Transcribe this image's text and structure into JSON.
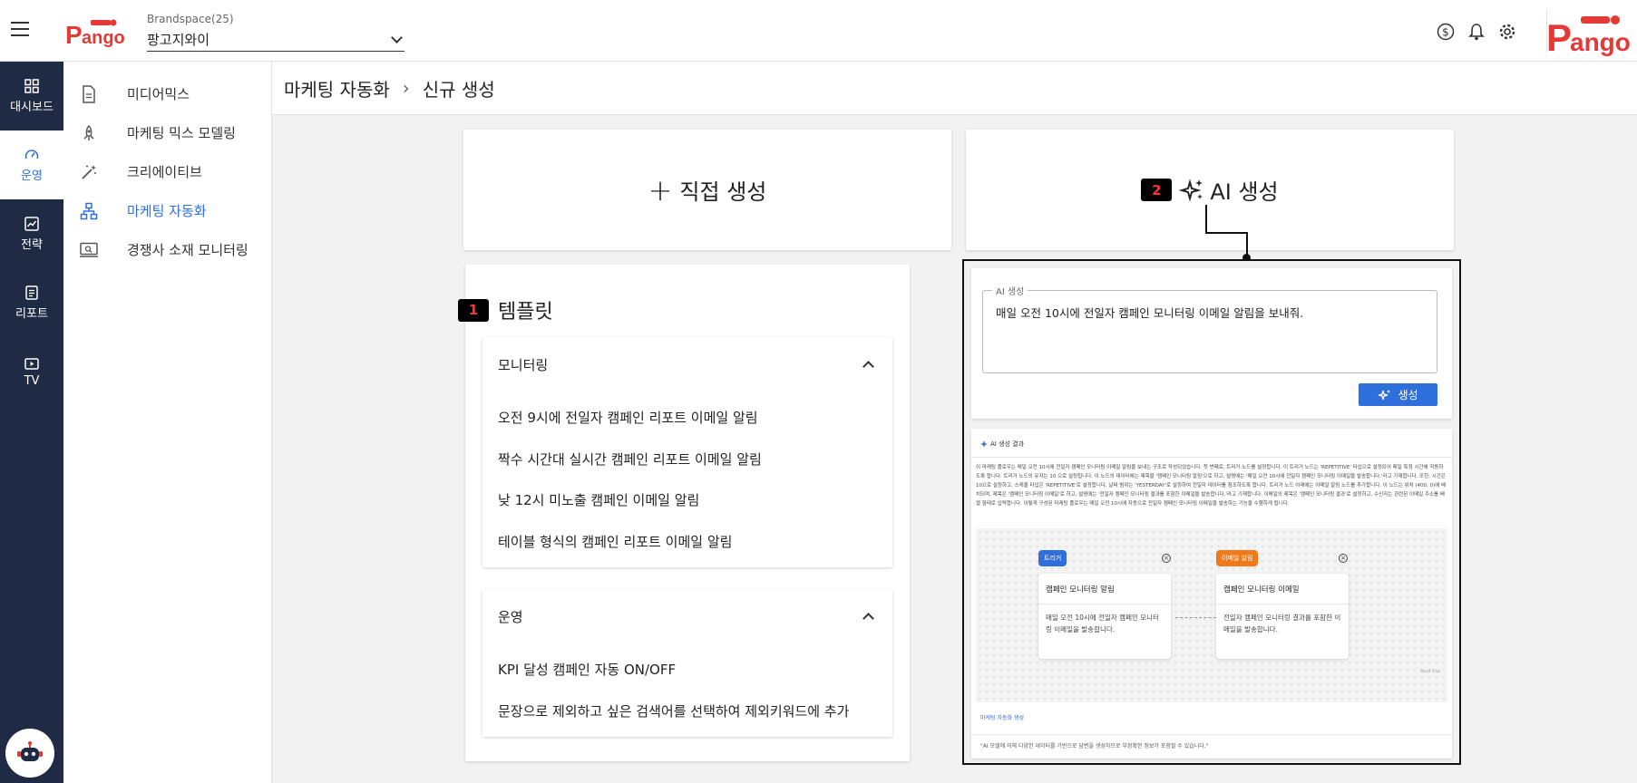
{
  "topbar": {
    "brandspace_label": "Brandspace(25)",
    "brandspace_value": "팡고지와이"
  },
  "rail": [
    {
      "label": "대시보드",
      "icon": "dashboard-icon"
    },
    {
      "label": "운영",
      "icon": "speedometer-icon",
      "active": true
    },
    {
      "label": "전략",
      "icon": "chart-icon"
    },
    {
      "label": "리포트",
      "icon": "report-icon"
    },
    {
      "label": "TV",
      "icon": "tv-icon"
    }
  ],
  "subnav": [
    {
      "label": "미디어믹스",
      "icon": "document-icon"
    },
    {
      "label": "마케팅 믹스 모델링",
      "icon": "rocket-icon"
    },
    {
      "label": "크리에이티브",
      "icon": "magic-wand-icon"
    },
    {
      "label": "마케팅 자동화",
      "icon": "hierarchy-icon",
      "active": true
    },
    {
      "label": "경쟁사 소재 모니터링",
      "icon": "monitor-icon"
    }
  ],
  "breadcrumb": {
    "parent": "마케팅 자동화",
    "separator": "›",
    "current": "신규 생성"
  },
  "create": {
    "direct_label": "직접 생성",
    "ai_label": "AI 생성",
    "ai_badge": "2"
  },
  "template": {
    "badge": "1",
    "title": "템플릿",
    "sections": [
      {
        "name": "모니터링",
        "items": [
          "오전 9시에 전일자 캠페인 리포트 이메일 알림",
          "짝수 시간대 실시간 캠페인 리포트 이메일 알림",
          "낮 12시 미노출 캠페인 이메일 알림",
          "테이블 형식의 캠페인 리포트 이메일 알림"
        ]
      },
      {
        "name": "운영",
        "items": [
          "KPI 달성 캠페인 자동 ON/OFF",
          "문장으로 제외하고 싶은 검색어를 선택하여 제외키워드에 추가"
        ]
      }
    ]
  },
  "ai": {
    "field_label": "AI 생성",
    "field_value": "매일 오전 10시에 전일자 캠페인 모니터링 이메일 알림을 보내줘.",
    "generate_label": "생성",
    "result_title": "AI 생성 결과",
    "result_desc": "이 마케팅 플로우는 매일 오전 10시에 전일자 캠페인 모니터링 이메일 알림을 보내는 구조로 작성되었습니다. 첫 번째로, 트리거 노드를 설정합니다. 이 트리거 노드는 'REPETITIVE' 타입으로 설정되어 매일 특정 시간에 작동하도록 합니다. 트리거 노드의 유지는 10 으로 설정됩니다. 이 노드의 데이터에는 제목을 '캠페인 모니터링 알림'으로 하고, 설명에는 '매일 오전 10시에 전일자 캠페인 모니터링 이메일을 발송합니다.'라고 기재합니다. 또한, 시간은 10으로 설정하고, 스케줄 타입은 'REPETITIVE'로 설정합니다. 날짜 범위는 'YESTERDAY'로 설정하여 전일자 데이터를 참조하도록 합니다. 트리거 노드 아래에는 이메일 알림 노드를 추가합니다. 이 노드는 위치 (400, 0)에 배치되며, 제목은 '캠페인 모니터링 이메일'로 하고, 설명에는 '전일자 캠페인 모니터링 결과를 포함한 이메일을 발송합니다.'라고 기재합니다. 이메일의 제목은 '캠페인 모니터링 결과'로 설정하고, 수신자는 관련된 이메일 주소를 배열 형태로 입력합니다. 이렇게 구성된 마케팅 플로우는 매일 오전 10시에 자동으로 전일자 캠페인 모니터링 이메일을 발송하는 기능을 수행하게 됩니다.",
    "nodes": [
      {
        "chip": "트리거",
        "chip_color": "#2f6fdb",
        "title": "캠페인 모니터링 알림",
        "desc": "매일 오전 10시에 전일자 캠페인 모니터링 이메일을 발송합니다."
      },
      {
        "chip": "이메일 알림",
        "chip_color": "#f07a1a",
        "title": "캠페인 모니터링 이메일",
        "desc": "전일자 캠페인 모니터링 결과를 포함한 이메일을 발송합니다."
      }
    ],
    "canvas_mark": "React Flow",
    "link_label": "마케팅 자동화 생성",
    "footnote": "\"AI 모델에 의해 다양한 데이터를 기반으로 답변을 생성하므로 부정확한 정보가 포함될 수 있습니다.\""
  },
  "colors": {
    "accent": "#2f6fdb",
    "rail_bg": "#1f2a44",
    "logo_red": "#e53935"
  }
}
